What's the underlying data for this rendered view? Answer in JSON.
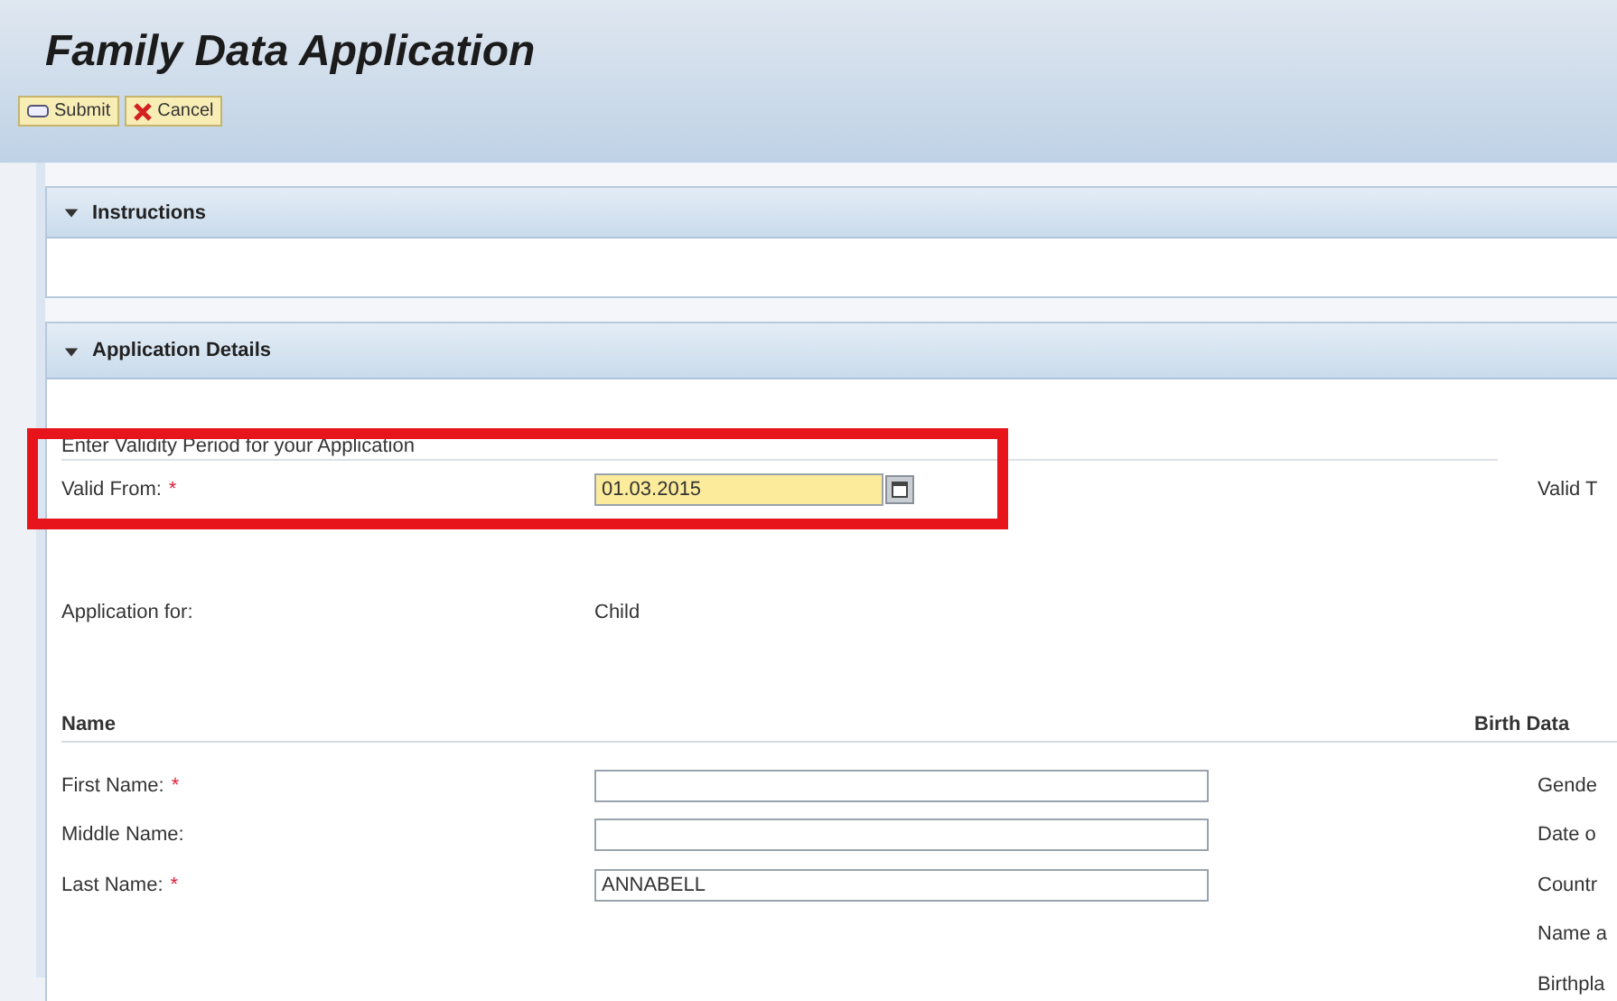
{
  "title": "Family Data Application",
  "toolbar": [
    {
      "label": "Submit",
      "kind": "submit"
    },
    {
      "label": "Cancel",
      "kind": "cancel"
    }
  ],
  "panels": [
    {
      "title": "Instructions",
      "expanded": true
    },
    {
      "title": "Application Details",
      "expanded": true
    }
  ],
  "validity": {
    "heading": "Enter Validity Period for your Application",
    "valid_from": {
      "label": "Valid From:",
      "required_mark": "*",
      "value": "01.03.2015",
      "highlighted": true
    },
    "valid_to_label": "Valid T"
  },
  "application_for": {
    "label": "Application for:",
    "value": "Child"
  },
  "name_section": {
    "heading": "Name",
    "fields": [
      {
        "label": "First Name:",
        "required_mark": "*"
      },
      {
        "label": "Middle Name:"
      },
      {
        "label": "Last Name:",
        "required_mark": "*",
        "value": "ANNABELL"
      }
    ]
  },
  "birth_data": {
    "heading": "Birth Data",
    "labels": [
      "Gende",
      "Date o",
      "Countr",
      "Name a",
      "Birthpla"
    ]
  }
}
